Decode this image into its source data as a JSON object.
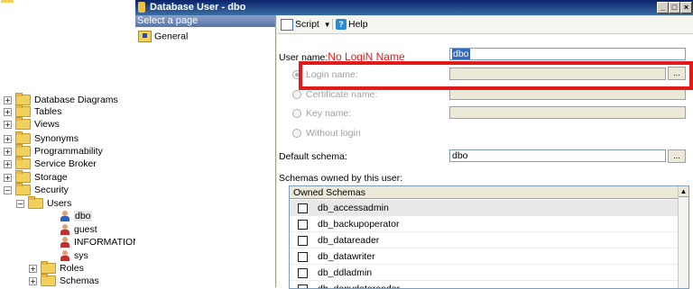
{
  "explorer": {
    "items": [
      {
        "label": "Database Diagrams",
        "expander": "+"
      },
      {
        "label": "Tables",
        "expander": "+"
      },
      {
        "label": "Views",
        "expander": "+"
      },
      {
        "label": "Synonyms",
        "expander": "+"
      },
      {
        "label": "Programmability",
        "expander": "+"
      },
      {
        "label": "Service Broker",
        "expander": "+"
      },
      {
        "label": "Storage",
        "expander": "+"
      },
      {
        "label": "Security",
        "expander": "−"
      },
      {
        "label": "Users",
        "expander": "−"
      },
      {
        "label": "dbo"
      },
      {
        "label": "guest"
      },
      {
        "label": "INFORMATION"
      },
      {
        "label": "sys"
      },
      {
        "label": "Roles",
        "expander": "+"
      },
      {
        "label": "Schemas",
        "expander": "+"
      }
    ]
  },
  "dialog": {
    "title": "Database User - dbo",
    "window_buttons": [
      "_",
      "□",
      "×"
    ],
    "select_page_header": "Select a page",
    "pages": [
      "General"
    ],
    "toolbar": {
      "script_label": "Script",
      "help_label": "Help"
    },
    "form": {
      "user_name_label": "User name:",
      "user_name_annotation": "No LogiN Name",
      "user_name_value": "dbo",
      "login_name_label": "Login name:",
      "certificate_name_label": "Certificate name:",
      "key_name_label": "Key name:",
      "without_login_label": "Without login",
      "default_schema_label": "Default schema:",
      "default_schema_value": "dbo",
      "browse_label": "...",
      "schemas_owned_label": "Schemas owned by this user:"
    },
    "schemas": {
      "header": "Owned Schemas",
      "rows": [
        "db_accessadmin",
        "db_backupoperator",
        "db_datareader",
        "db_datawriter",
        "db_ddladmin",
        "db_denydatareader"
      ]
    }
  },
  "colors": {
    "highlight_box": "#e21a1a",
    "annotation_text": "#e02020",
    "titlebar": "#0a246a"
  },
  "icons": [
    "folder-icon",
    "user-icon",
    "script-icon",
    "help-icon",
    "page-icon"
  ]
}
